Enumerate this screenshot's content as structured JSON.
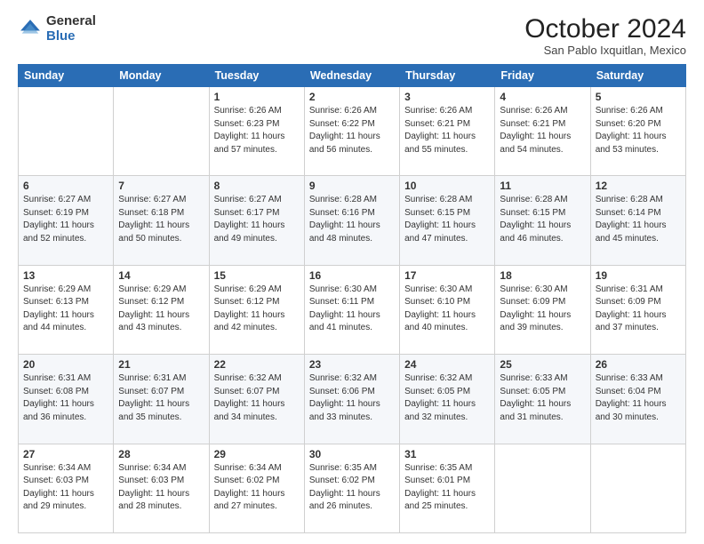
{
  "logo": {
    "general": "General",
    "blue": "Blue"
  },
  "title": "October 2024",
  "location": "San Pablo Ixquitlan, Mexico",
  "days_header": [
    "Sunday",
    "Monday",
    "Tuesday",
    "Wednesday",
    "Thursday",
    "Friday",
    "Saturday"
  ],
  "weeks": [
    [
      {
        "day": "",
        "sunrise": "",
        "sunset": "",
        "daylight": ""
      },
      {
        "day": "",
        "sunrise": "",
        "sunset": "",
        "daylight": ""
      },
      {
        "day": "1",
        "sunrise": "Sunrise: 6:26 AM",
        "sunset": "Sunset: 6:23 PM",
        "daylight": "Daylight: 11 hours and 57 minutes."
      },
      {
        "day": "2",
        "sunrise": "Sunrise: 6:26 AM",
        "sunset": "Sunset: 6:22 PM",
        "daylight": "Daylight: 11 hours and 56 minutes."
      },
      {
        "day": "3",
        "sunrise": "Sunrise: 6:26 AM",
        "sunset": "Sunset: 6:21 PM",
        "daylight": "Daylight: 11 hours and 55 minutes."
      },
      {
        "day": "4",
        "sunrise": "Sunrise: 6:26 AM",
        "sunset": "Sunset: 6:21 PM",
        "daylight": "Daylight: 11 hours and 54 minutes."
      },
      {
        "day": "5",
        "sunrise": "Sunrise: 6:26 AM",
        "sunset": "Sunset: 6:20 PM",
        "daylight": "Daylight: 11 hours and 53 minutes."
      }
    ],
    [
      {
        "day": "6",
        "sunrise": "Sunrise: 6:27 AM",
        "sunset": "Sunset: 6:19 PM",
        "daylight": "Daylight: 11 hours and 52 minutes."
      },
      {
        "day": "7",
        "sunrise": "Sunrise: 6:27 AM",
        "sunset": "Sunset: 6:18 PM",
        "daylight": "Daylight: 11 hours and 50 minutes."
      },
      {
        "day": "8",
        "sunrise": "Sunrise: 6:27 AM",
        "sunset": "Sunset: 6:17 PM",
        "daylight": "Daylight: 11 hours and 49 minutes."
      },
      {
        "day": "9",
        "sunrise": "Sunrise: 6:28 AM",
        "sunset": "Sunset: 6:16 PM",
        "daylight": "Daylight: 11 hours and 48 minutes."
      },
      {
        "day": "10",
        "sunrise": "Sunrise: 6:28 AM",
        "sunset": "Sunset: 6:15 PM",
        "daylight": "Daylight: 11 hours and 47 minutes."
      },
      {
        "day": "11",
        "sunrise": "Sunrise: 6:28 AM",
        "sunset": "Sunset: 6:15 PM",
        "daylight": "Daylight: 11 hours and 46 minutes."
      },
      {
        "day": "12",
        "sunrise": "Sunrise: 6:28 AM",
        "sunset": "Sunset: 6:14 PM",
        "daylight": "Daylight: 11 hours and 45 minutes."
      }
    ],
    [
      {
        "day": "13",
        "sunrise": "Sunrise: 6:29 AM",
        "sunset": "Sunset: 6:13 PM",
        "daylight": "Daylight: 11 hours and 44 minutes."
      },
      {
        "day": "14",
        "sunrise": "Sunrise: 6:29 AM",
        "sunset": "Sunset: 6:12 PM",
        "daylight": "Daylight: 11 hours and 43 minutes."
      },
      {
        "day": "15",
        "sunrise": "Sunrise: 6:29 AM",
        "sunset": "Sunset: 6:12 PM",
        "daylight": "Daylight: 11 hours and 42 minutes."
      },
      {
        "day": "16",
        "sunrise": "Sunrise: 6:30 AM",
        "sunset": "Sunset: 6:11 PM",
        "daylight": "Daylight: 11 hours and 41 minutes."
      },
      {
        "day": "17",
        "sunrise": "Sunrise: 6:30 AM",
        "sunset": "Sunset: 6:10 PM",
        "daylight": "Daylight: 11 hours and 40 minutes."
      },
      {
        "day": "18",
        "sunrise": "Sunrise: 6:30 AM",
        "sunset": "Sunset: 6:09 PM",
        "daylight": "Daylight: 11 hours and 39 minutes."
      },
      {
        "day": "19",
        "sunrise": "Sunrise: 6:31 AM",
        "sunset": "Sunset: 6:09 PM",
        "daylight": "Daylight: 11 hours and 37 minutes."
      }
    ],
    [
      {
        "day": "20",
        "sunrise": "Sunrise: 6:31 AM",
        "sunset": "Sunset: 6:08 PM",
        "daylight": "Daylight: 11 hours and 36 minutes."
      },
      {
        "day": "21",
        "sunrise": "Sunrise: 6:31 AM",
        "sunset": "Sunset: 6:07 PM",
        "daylight": "Daylight: 11 hours and 35 minutes."
      },
      {
        "day": "22",
        "sunrise": "Sunrise: 6:32 AM",
        "sunset": "Sunset: 6:07 PM",
        "daylight": "Daylight: 11 hours and 34 minutes."
      },
      {
        "day": "23",
        "sunrise": "Sunrise: 6:32 AM",
        "sunset": "Sunset: 6:06 PM",
        "daylight": "Daylight: 11 hours and 33 minutes."
      },
      {
        "day": "24",
        "sunrise": "Sunrise: 6:32 AM",
        "sunset": "Sunset: 6:05 PM",
        "daylight": "Daylight: 11 hours and 32 minutes."
      },
      {
        "day": "25",
        "sunrise": "Sunrise: 6:33 AM",
        "sunset": "Sunset: 6:05 PM",
        "daylight": "Daylight: 11 hours and 31 minutes."
      },
      {
        "day": "26",
        "sunrise": "Sunrise: 6:33 AM",
        "sunset": "Sunset: 6:04 PM",
        "daylight": "Daylight: 11 hours and 30 minutes."
      }
    ],
    [
      {
        "day": "27",
        "sunrise": "Sunrise: 6:34 AM",
        "sunset": "Sunset: 6:03 PM",
        "daylight": "Daylight: 11 hours and 29 minutes."
      },
      {
        "day": "28",
        "sunrise": "Sunrise: 6:34 AM",
        "sunset": "Sunset: 6:03 PM",
        "daylight": "Daylight: 11 hours and 28 minutes."
      },
      {
        "day": "29",
        "sunrise": "Sunrise: 6:34 AM",
        "sunset": "Sunset: 6:02 PM",
        "daylight": "Daylight: 11 hours and 27 minutes."
      },
      {
        "day": "30",
        "sunrise": "Sunrise: 6:35 AM",
        "sunset": "Sunset: 6:02 PM",
        "daylight": "Daylight: 11 hours and 26 minutes."
      },
      {
        "day": "31",
        "sunrise": "Sunrise: 6:35 AM",
        "sunset": "Sunset: 6:01 PM",
        "daylight": "Daylight: 11 hours and 25 minutes."
      },
      {
        "day": "",
        "sunrise": "",
        "sunset": "",
        "daylight": ""
      },
      {
        "day": "",
        "sunrise": "",
        "sunset": "",
        "daylight": ""
      }
    ]
  ]
}
